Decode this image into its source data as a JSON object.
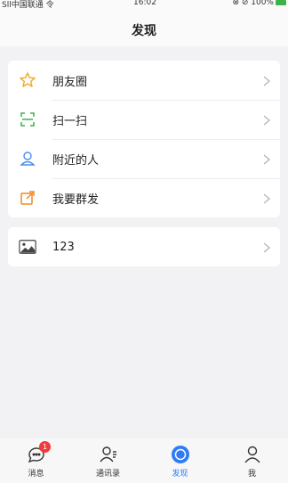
{
  "status_bar": {
    "carrier": "Sll中国联通 令",
    "time": "16:02",
    "right": "⊗ ⊘ 100%"
  },
  "nav": {
    "title": "发现"
  },
  "menu": [
    {
      "label": "朋友圈",
      "icon": "star-icon"
    },
    {
      "label": "扫一扫",
      "icon": "scan-icon"
    },
    {
      "label": "附近的人",
      "icon": "nearby-person-icon"
    },
    {
      "label": "我要群发",
      "icon": "broadcast-icon"
    }
  ],
  "extra": [
    {
      "label": "123",
      "icon": "image-icon"
    }
  ],
  "tabs": [
    {
      "label": "消息",
      "icon": "chat-icon",
      "badge": "1"
    },
    {
      "label": "通讯录",
      "icon": "contacts-icon"
    },
    {
      "label": "发现",
      "icon": "discover-icon",
      "active": true
    },
    {
      "label": "我",
      "icon": "profile-icon"
    }
  ],
  "colors": {
    "accent": "#2f7cf6",
    "badge": "#f23a3a",
    "icon_orange": "#f5a623",
    "icon_green": "#3cb34a"
  }
}
